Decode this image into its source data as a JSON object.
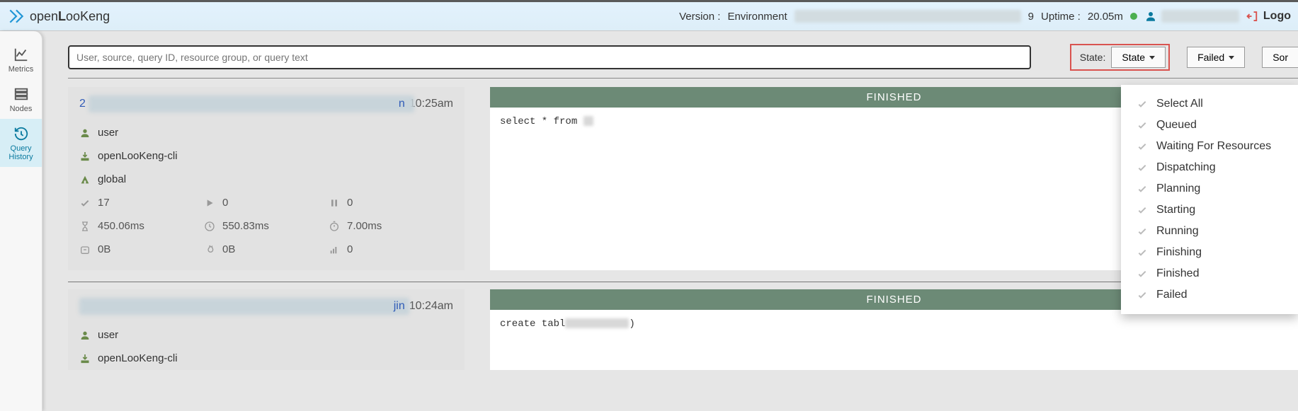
{
  "header": {
    "logo_prefix": "open",
    "logo_bold": "L",
    "logo_rest": "ooKeng",
    "version_label": "Version :",
    "environment_label": "Environment",
    "env_tail": "9",
    "uptime_label": "Uptime :",
    "uptime_value": "20.05m",
    "logout_label": "Logo"
  },
  "sidebar": {
    "items": [
      {
        "label": "Metrics"
      },
      {
        "label": "Nodes"
      },
      {
        "label": "Query History"
      }
    ]
  },
  "filter": {
    "search_placeholder": "User, source, query ID, resource group, or query text",
    "state_label": "State:",
    "state_button": "State",
    "failed_button": "Failed",
    "sort_button": "Sor"
  },
  "state_menu": [
    "Select All",
    "Queued",
    "Waiting For Resources",
    "Dispatching",
    "Planning",
    "Starting",
    "Running",
    "Finishing",
    "Finished",
    "Failed"
  ],
  "queries": [
    {
      "id_tail": "n",
      "time": "10:25am",
      "user": "user",
      "source": "openLooKeng-cli",
      "group": "global",
      "status": "FINISHED",
      "sql": "select * from ",
      "rows_done": "17",
      "rows_running": "0",
      "rows_queued": "0",
      "time_queued": "450.06ms",
      "time_wall": "550.83ms",
      "time_cpu": "7.00ms",
      "mem_current": "0B",
      "mem_peak": "0B",
      "cumulative": "0"
    },
    {
      "id_tail": "jin",
      "time": "10:24am",
      "user": "user",
      "source": "openLooKeng-cli",
      "status": "FINISHED",
      "sql_prefix": "create tabl",
      "sql_suffix": ")"
    }
  ]
}
